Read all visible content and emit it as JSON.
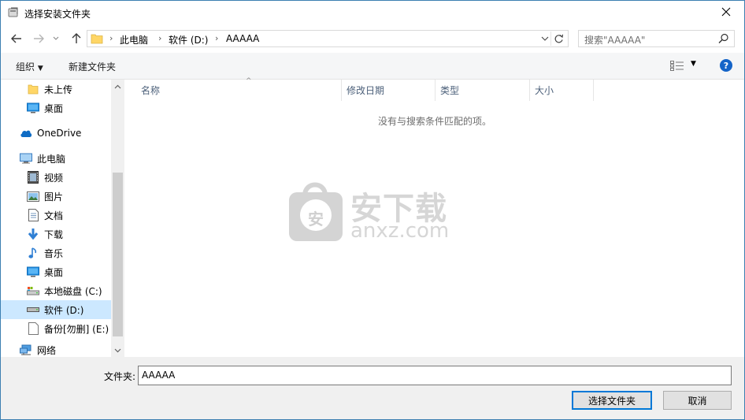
{
  "window": {
    "title": "选择安装文件夹",
    "close_label": "✕"
  },
  "nav": {
    "breadcrumbs": [
      "此电脑",
      "软件 (D:)",
      "AAAAA"
    ],
    "search_placeholder": "搜索\"AAAAA\""
  },
  "toolbar": {
    "organize": "组织",
    "new_folder": "新建文件夹",
    "help": "?"
  },
  "sidebar": {
    "items": [
      {
        "label": "未上传",
        "icon": "folder-icon"
      },
      {
        "label": "桌面",
        "icon": "desktop-icon"
      },
      {
        "label": "OneDrive",
        "icon": "cloud-icon"
      },
      {
        "label": "此电脑",
        "icon": "computer-icon"
      },
      {
        "label": "视频",
        "icon": "video-icon"
      },
      {
        "label": "图片",
        "icon": "picture-icon"
      },
      {
        "label": "文档",
        "icon": "document-icon"
      },
      {
        "label": "下载",
        "icon": "download-icon"
      },
      {
        "label": "音乐",
        "icon": "music-icon"
      },
      {
        "label": "桌面",
        "icon": "desktop-icon"
      },
      {
        "label": "本地磁盘 (C:)",
        "icon": "drive-c-icon"
      },
      {
        "label": "软件 (D:)",
        "icon": "drive-icon"
      },
      {
        "label": "备份[勿删] (E:)",
        "icon": "drive-e-icon"
      },
      {
        "label": "网络",
        "icon": "network-icon"
      }
    ]
  },
  "content": {
    "columns": [
      "名称",
      "修改日期",
      "类型",
      "大小"
    ],
    "empty_message": "没有与搜索条件匹配的项。",
    "watermark_text": "安下载",
    "watermark_domain": "anxz.com",
    "watermark_badge": "安"
  },
  "footer": {
    "folder_label": "文件夹:",
    "folder_value": "AAAAA",
    "select_button": "选择文件夹",
    "cancel_button": "取消"
  },
  "colors": {
    "accent": "#0078d7",
    "selection": "#cce8ff",
    "help": "#1464c8"
  }
}
